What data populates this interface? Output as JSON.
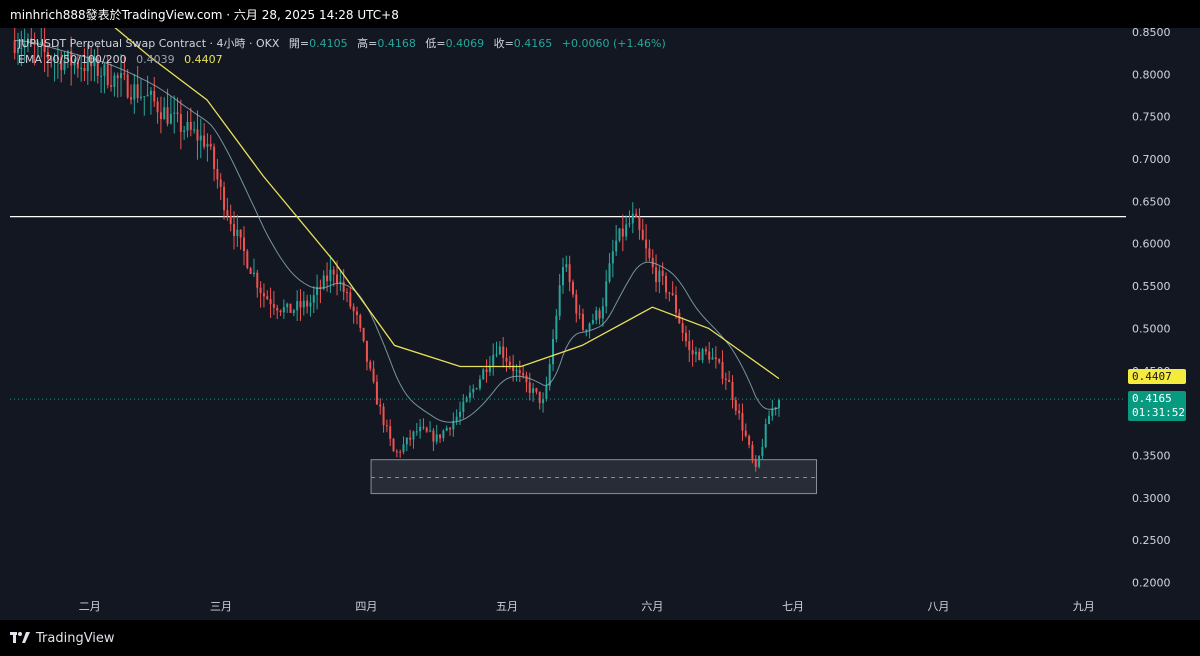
{
  "header": {
    "caption": "minhrich888發表於TradingView.com · 六月 28, 2025 14:28 UTC+8"
  },
  "legend": {
    "symbol": "JUPUSDT Perpetual Swap Contract · 4小時 · OKX",
    "open_label": "開=",
    "open": "0.4105",
    "high_label": "高=",
    "high": "0.4168",
    "low_label": "低=",
    "low": "0.4069",
    "close_label": "收=",
    "close": "0.4165",
    "change": "+0.0060 (+1.46%)",
    "ema_label": "EMA 20/50/100/200",
    "ema_fast": "0.4039",
    "ema_slow": "0.4407"
  },
  "price_tags": {
    "ema": "0.4407",
    "last": "0.4165",
    "countdown": "01:31:52"
  },
  "footer": {
    "brand": "TradingView"
  },
  "colors": {
    "up": "#26a69a",
    "down": "#ef5350",
    "ema_fast": "#9aa0ad",
    "ema_slow": "#e9e15a",
    "last_price": "#089981",
    "background": "#131722"
  },
  "chart_data": {
    "type": "line",
    "series": [
      {
        "name": "JUPUSDT Perpetual Swap Contract",
        "x": [
          "2025-01-16",
          "2025-01-24",
          "2025-02-01",
          "2025-02-08",
          "2025-02-14",
          "2025-02-20",
          "2025-02-26",
          "2025-03-01",
          "2025-03-05",
          "2025-03-10",
          "2025-03-15",
          "2025-03-20",
          "2025-03-25",
          "2025-03-30",
          "2025-04-03",
          "2025-04-07",
          "2025-04-12",
          "2025-04-16",
          "2025-04-21",
          "2025-04-25",
          "2025-04-29",
          "2025-05-04",
          "2025-05-09",
          "2025-05-13",
          "2025-05-17",
          "2025-05-21",
          "2025-05-24",
          "2025-05-28",
          "2025-06-01",
          "2025-06-05",
          "2025-06-09",
          "2025-06-13",
          "2025-06-17",
          "2025-06-21",
          "2025-06-23",
          "2025-06-26",
          "2025-06-28"
        ],
        "values": [
          0.84,
          0.82,
          0.81,
          0.79,
          0.77,
          0.74,
          0.72,
          0.66,
          0.6,
          0.54,
          0.52,
          0.53,
          0.57,
          0.51,
          0.42,
          0.35,
          0.38,
          0.37,
          0.4,
          0.44,
          0.48,
          0.44,
          0.41,
          0.58,
          0.5,
          0.52,
          0.6,
          0.63,
          0.57,
          0.54,
          0.47,
          0.47,
          0.44,
          0.37,
          0.33,
          0.4,
          0.4165
        ]
      },
      {
        "name": "EMA 200",
        "x": [
          "2025-01-16",
          "2025-02-01",
          "2025-02-14",
          "2025-02-26",
          "2025-03-10",
          "2025-03-25",
          "2025-04-07",
          "2025-04-21",
          "2025-05-04",
          "2025-05-17",
          "2025-06-01",
          "2025-06-13",
          "2025-06-28"
        ],
        "values": [
          0.93,
          0.88,
          0.82,
          0.77,
          0.68,
          0.58,
          0.48,
          0.455,
          0.455,
          0.48,
          0.525,
          0.5,
          0.4407
        ]
      }
    ],
    "horizontal_line": 0.632,
    "support_zone": {
      "from": "2025-04-02",
      "to": "2025-07-06",
      "low": 0.305,
      "high": 0.345,
      "mid": 0.324
    },
    "ylim": [
      0.17,
      0.86
    ],
    "yticks": [
      "0.8500",
      "0.8000",
      "0.7500",
      "0.7000",
      "0.6500",
      "0.6000",
      "0.5500",
      "0.5000",
      "0.4500",
      "0.3500",
      "0.3000",
      "0.2500",
      "0.2000"
    ],
    "xticks": [
      "二月",
      "三月",
      "四月",
      "五月",
      "六月",
      "七月",
      "八月",
      "九月"
    ],
    "xtick_dates": [
      "2025-02-01",
      "2025-03-01",
      "2025-04-01",
      "2025-05-01",
      "2025-06-01",
      "2025-07-01",
      "2025-08-01",
      "2025-09-01"
    ],
    "xlim": [
      "2025-01-15",
      "2025-09-10"
    ],
    "grid": false
  }
}
